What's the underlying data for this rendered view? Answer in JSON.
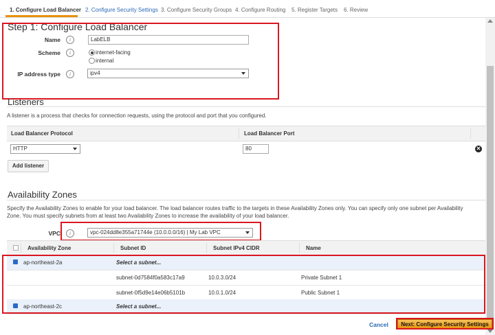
{
  "tabs": [
    {
      "label": "1. Configure Load Balancer"
    },
    {
      "label": "2. Configure Security Settings"
    },
    {
      "label": "3. Configure Security Groups"
    },
    {
      "label": "4. Configure Routing"
    },
    {
      "label": "5. Register Targets"
    },
    {
      "label": "6. Review"
    }
  ],
  "step": {
    "title": "Step 1: Configure Load Balancer",
    "name_label": "Name",
    "name_value": "LabELB",
    "scheme_label": "Scheme",
    "scheme_options": [
      "internet-facing",
      "internal"
    ],
    "scheme_selected": "internet-facing",
    "ip_label": "IP address type",
    "ip_value": "ipv4"
  },
  "listeners": {
    "title": "Listeners",
    "description": "A listener is a process that checks for connection requests, using the protocol and port that you configured.",
    "col_protocol": "Load Balancer Protocol",
    "col_port": "Load Balancer Port",
    "protocol_value": "HTTP",
    "port_value": "80",
    "add_button": "Add listener"
  },
  "az": {
    "title": "Availability Zones",
    "description_1": "Specify the Availability Zones to enable for your load balancer. The load balancer routes traffic to the targets in these Availability Zones only. You can specify only one subnet per Availability",
    "description_2": "Zone. You must specify subnets from at least two Availability Zones to increase the availability of your load balancer.",
    "vpc_label": "VPC",
    "vpc_value": "vpc-024dd8e355a71744e (10.0.0.0/16) | My Lab VPC",
    "columns": [
      "Availability Zone",
      "Subnet ID",
      "Subnet IPv4 CIDR",
      "Name"
    ],
    "rows": [
      {
        "zone": "ap-northeast-2a",
        "subnet": "Select a subnet...",
        "cidr": "",
        "name": ""
      },
      {
        "zone": "",
        "subnet": "subnet-0d7584f0a583c17a9",
        "cidr": "10.0.3.0/24",
        "name": "Private Subnet 1"
      },
      {
        "zone": "",
        "subnet": "subnet-0f5d9e14e06b5101b",
        "cidr": "10.0.1.0/24",
        "name": "Public Subnet 1"
      },
      {
        "zone": "ap-northeast-2c",
        "subnet": "Select a subnet...",
        "cidr": "",
        "name": ""
      }
    ]
  },
  "footer": {
    "cancel": "Cancel",
    "next": "Next: Configure Security Settings"
  },
  "colors": {
    "accent": "#e8900c",
    "highlight": "#d9161f",
    "link": "#2a6ab8"
  }
}
